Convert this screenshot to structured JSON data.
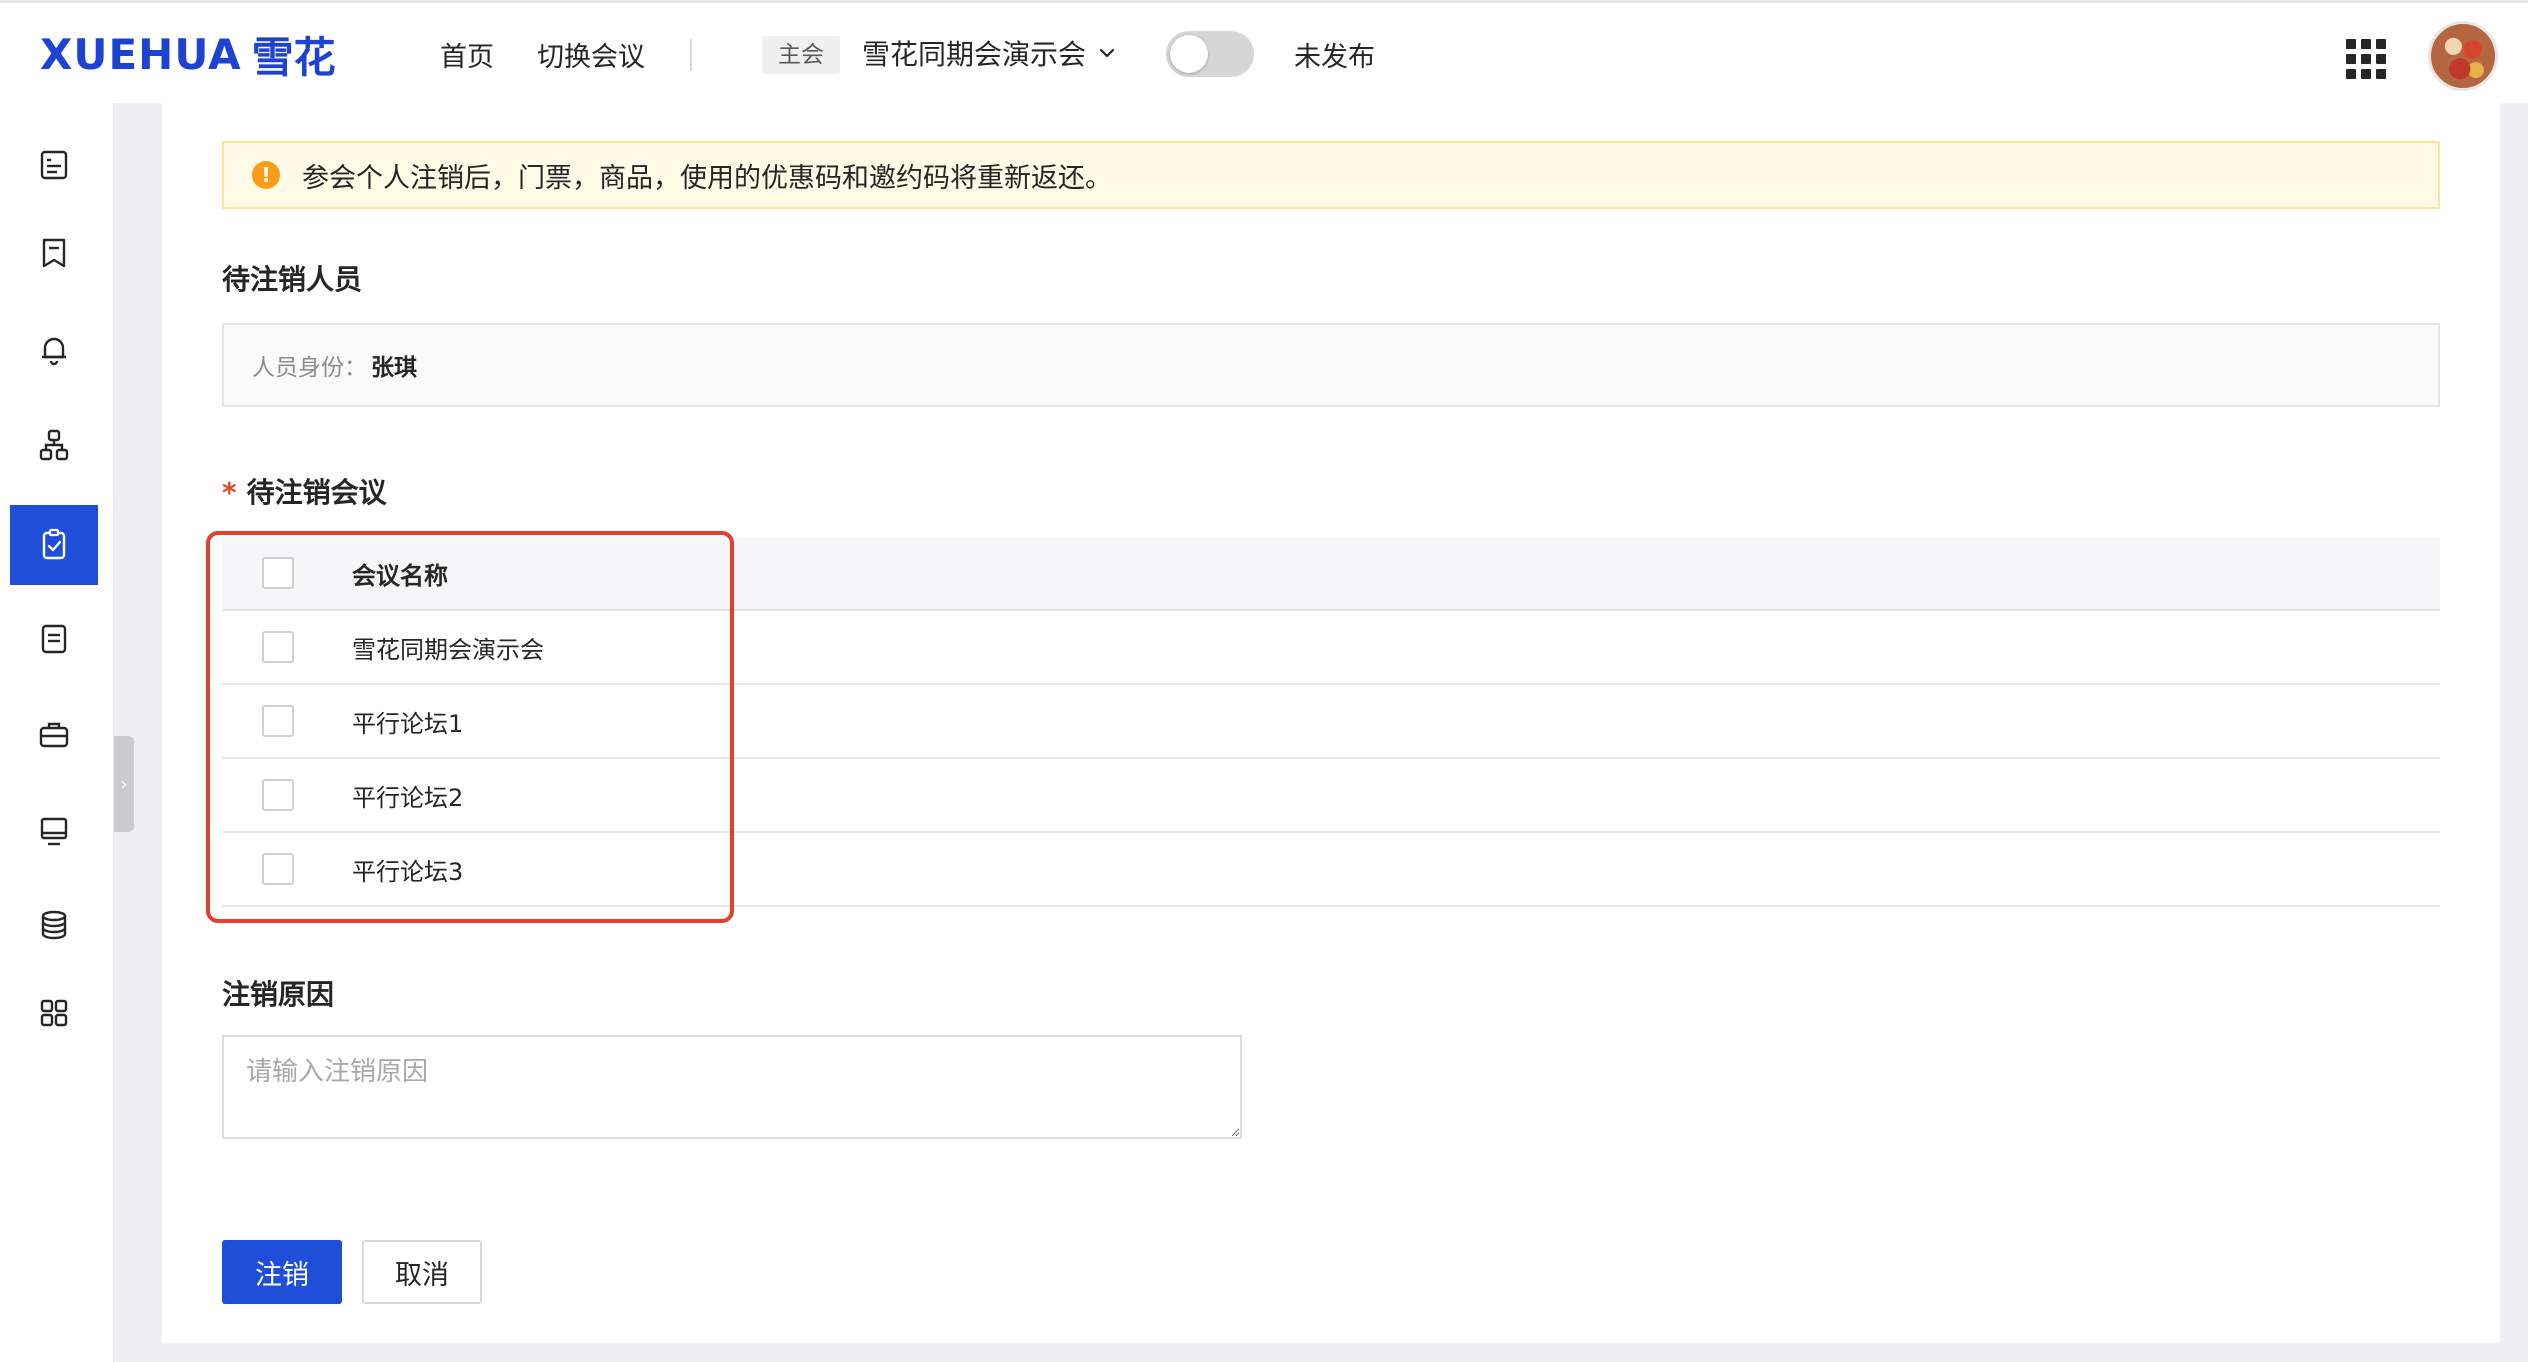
{
  "header": {
    "logo_latin": "XUEHUA",
    "logo_cjk": "雪花",
    "nav": [
      {
        "label": "首页"
      },
      {
        "label": "切换会议"
      }
    ],
    "main_badge": "主会",
    "current_conference": "雪花同期会演示会",
    "publish_status": "未发布"
  },
  "sidebar": {
    "items": [
      {
        "icon": "list-doc-icon"
      },
      {
        "icon": "bookmark-icon"
      },
      {
        "icon": "bell-icon"
      },
      {
        "icon": "org-chart-icon"
      },
      {
        "icon": "checklist-icon",
        "active": true
      },
      {
        "icon": "document-icon"
      },
      {
        "icon": "briefcase-icon"
      },
      {
        "icon": "monitor-icon"
      },
      {
        "icon": "database-icon"
      },
      {
        "icon": "grid-apps-icon"
      }
    ]
  },
  "notice": {
    "text": "参会个人注销后，门票，商品，使用的优惠码和邀约码将重新返还。"
  },
  "pending_person": {
    "title": "待注销人员",
    "label": "人员身份：",
    "value": "张琪"
  },
  "pending_meetings": {
    "title": "待注销会议",
    "column_header": "会议名称",
    "rows": [
      {
        "name": "雪花同期会演示会"
      },
      {
        "name": "平行论坛1"
      },
      {
        "name": "平行论坛2"
      },
      {
        "name": "平行论坛3"
      }
    ]
  },
  "reason": {
    "title": "注销原因",
    "placeholder": "请输入注销原因"
  },
  "actions": {
    "submit_label": "注销",
    "cancel_label": "取消"
  },
  "colors": {
    "brand": "#1f4fd8",
    "warning": "#fa9d14",
    "highlight": "#e3402c"
  }
}
